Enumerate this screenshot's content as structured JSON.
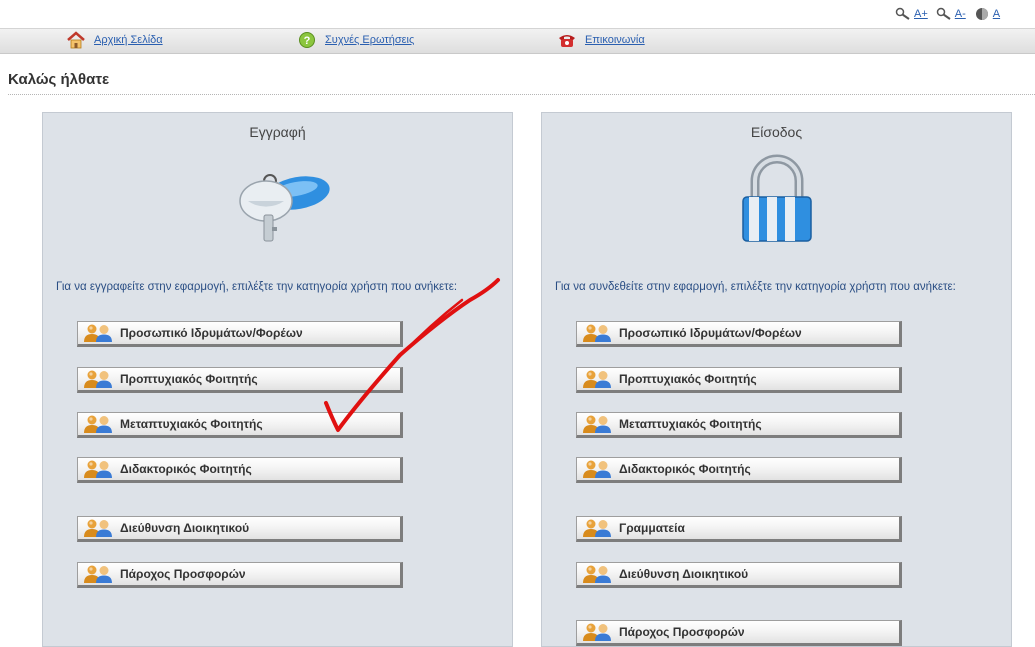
{
  "accessibility": {
    "increase_font": "A+",
    "decrease_font": "A-",
    "contrast": "A"
  },
  "nav": {
    "home": "Αρχική Σελίδα",
    "faq": "Συχνές Ερωτήσεις",
    "contact": "Επικοινωνία"
  },
  "page_title": "Καλώς ήλθατε",
  "register": {
    "title": "Εγγραφή",
    "description": "Για να εγγραφείτε στην εφαρμογή, επιλέξτε την κατηγορία χρήστη που ανήκετε:",
    "buttons": [
      "Προσωπικό Ιδρυμάτων/Φορέων",
      "Προπτυχιακός Φοιτητής",
      "Μεταπτυχιακός Φοιτητής",
      "Διδακτορικός Φοιτητής",
      "Διεύθυνση Διοικητικού",
      "Πάροχος Προσφορών"
    ]
  },
  "login": {
    "title": "Είσοδος",
    "description": "Για να συνδεθείτε στην εφαρμογή, επιλέξτε την κατηγορία χρήστη που ανήκετε:",
    "buttons": [
      "Προσωπικό Ιδρυμάτων/Φορέων",
      "Προπτυχιακός Φοιτητής",
      "Μεταπτυχιακός Φοιτητής",
      "Διδακτορικός Φοιτητής",
      "Γραμματεία",
      "Διεύθυνση Διοικητικού",
      "Πάροχος Προσφορών"
    ]
  },
  "colors": {
    "link": "#2a5fb0",
    "panel_bg": "#dde2e8",
    "annotation": "#e01010"
  },
  "icons": {
    "home": "house-icon",
    "faq": "question-icon",
    "contact": "telephone-icon",
    "register": "keys-icon",
    "login": "padlock-icon",
    "user": "users-icon"
  }
}
